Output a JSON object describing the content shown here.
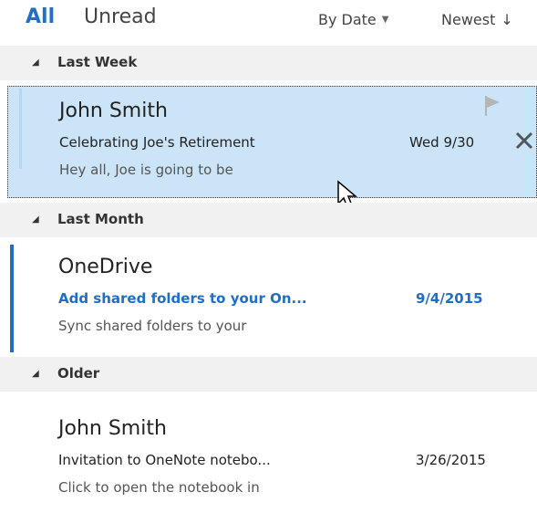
{
  "filter": {
    "all": "All",
    "unread": "Unread"
  },
  "sort": {
    "by": "By Date",
    "order": "Newest",
    "order_arrow": "↓",
    "caret": "▼"
  },
  "groups": [
    {
      "title": "Last Week"
    },
    {
      "title": "Last Month"
    },
    {
      "title": "Older"
    }
  ],
  "group_arrow": "◢",
  "messages": [
    {
      "sender": "John Smith",
      "subject": "Celebrating Joe's Retirement",
      "preview": "Hey all,   Joe is going to be",
      "date": "Wed 9/30"
    },
    {
      "sender": "OneDrive",
      "subject": "Add shared folders to your On...",
      "preview": "Sync shared folders to your",
      "date": "9/4/2015"
    },
    {
      "sender": "John Smith",
      "subject": "Invitation to OneNote notebo...",
      "preview": "Click to open the notebook in",
      "date": "3/26/2015"
    }
  ],
  "colors": {
    "accent": "#1e6fc5",
    "selected_bg": "#cce4f7",
    "group_bg": "#f1f1f1"
  }
}
